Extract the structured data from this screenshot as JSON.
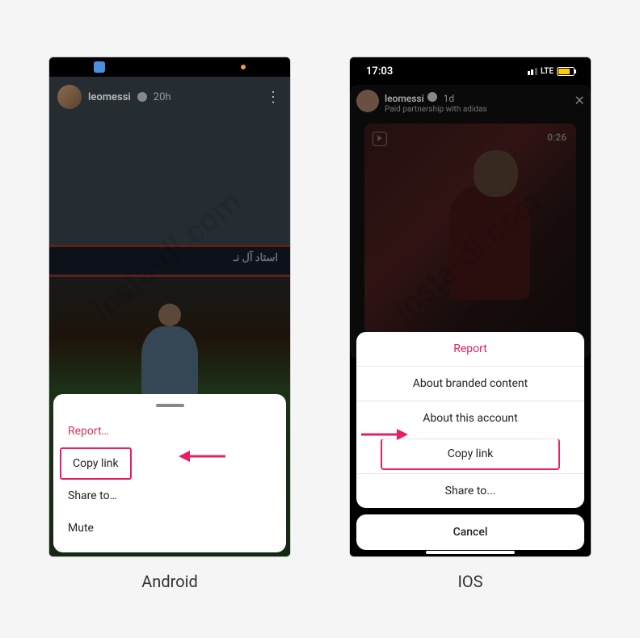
{
  "watermark": "insta-dl.com",
  "android": {
    "caption": "Android",
    "username": "leomessi",
    "time": "20h",
    "arabic_text": "استاد آل نـ",
    "sheet": {
      "report": "Report…",
      "copy_link": "Copy link",
      "share_to": "Share to…",
      "mute": "Mute"
    }
  },
  "ios": {
    "caption": "IOS",
    "status_time": "17:03",
    "lte": "LTE",
    "username": "leomessi",
    "time_inline": "1d",
    "subtitle": "Paid partnership with adidas",
    "duration": "0:26",
    "sheet": {
      "report": "Report",
      "about_branded": "About branded content",
      "about_account": "About this account",
      "copy_link": "Copy link",
      "share_to": "Share to...",
      "cancel": "Cancel"
    }
  }
}
